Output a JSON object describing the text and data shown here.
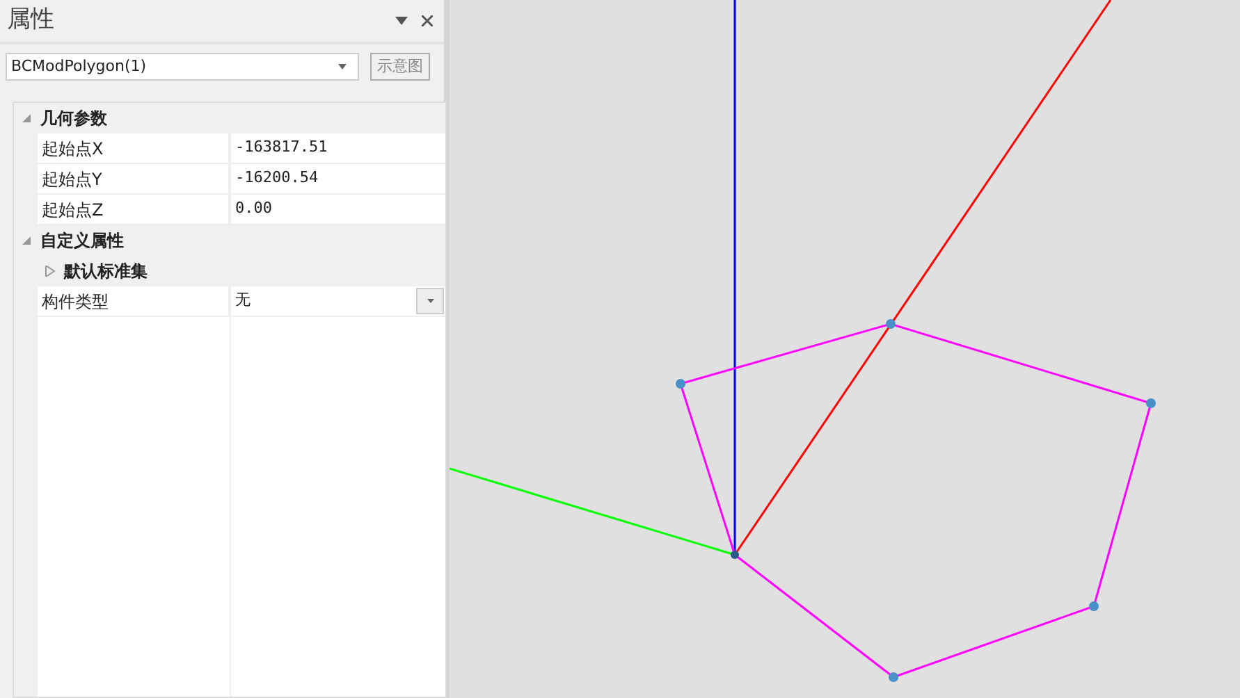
{
  "panel": {
    "title": "属性",
    "object_select": {
      "value": "BCModPolygon(1)"
    },
    "schematic_button": {
      "label": "示意图",
      "disabled": true
    }
  },
  "property_grid": [
    {
      "kind": "group",
      "label": "几何参数",
      "expanded": true,
      "children": [
        {
          "kind": "property",
          "name": "起始点X",
          "value": "-163817.51"
        },
        {
          "kind": "property",
          "name": "起始点Y",
          "value": "-16200.54"
        },
        {
          "kind": "property",
          "name": "起始点Z",
          "value": "0.00"
        }
      ]
    },
    {
      "kind": "group",
      "label": "自定义属性",
      "expanded": true,
      "children": [
        {
          "kind": "subgroup",
          "label": "默认标准集",
          "expanded": false
        },
        {
          "kind": "dropdown",
          "name": "构件类型",
          "value": "无"
        }
      ]
    }
  ]
}
